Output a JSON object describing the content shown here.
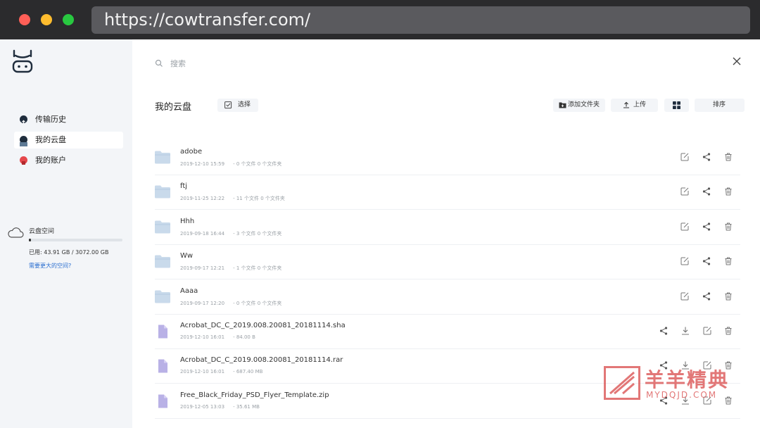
{
  "browser": {
    "url": "https://cowtransfer.com/"
  },
  "sidebar": {
    "items": [
      {
        "label": "传输历史",
        "icon": "upload-circle-icon",
        "color": "#1f2d3d"
      },
      {
        "label": "我的云盘",
        "icon": "disk-icon",
        "color": "#1f2d3d",
        "active": true
      },
      {
        "label": "我的账户",
        "icon": "account-icon",
        "color": "#e5474b"
      }
    ],
    "storage": {
      "title": "云盘空间",
      "used_text": "已用: 43.91 GB / 3072.00 GB",
      "used_fraction": 0.0143,
      "more_link": "需要更大的空间?"
    }
  },
  "search": {
    "placeholder": "搜索"
  },
  "main": {
    "title": "我的云盘",
    "select_label": "选择",
    "toolbar": {
      "add_folder": "添加文件夹",
      "upload": "上传",
      "sort": "排序"
    },
    "rows": [
      {
        "type": "folder",
        "name": "adobe",
        "date": "2019-12-10 15:59",
        "info": "- 0 个文件 0 个文件夹"
      },
      {
        "type": "folder",
        "name": "ftj",
        "date": "2019-11-25 12:22",
        "info": "- 11 个文件 0 个文件夹"
      },
      {
        "type": "folder",
        "name": "Hhh",
        "date": "2019-09-18 16:44",
        "info": "- 3 个文件 0 个文件夹"
      },
      {
        "type": "folder",
        "name": "Ww",
        "date": "2019-09-17 12:21",
        "info": "- 1 个文件 0 个文件夹"
      },
      {
        "type": "folder",
        "name": "Aaaa",
        "date": "2019-09-17 12:20",
        "info": "- 0 个文件 0 个文件夹"
      },
      {
        "type": "file",
        "name": "Acrobat_DC_C_2019.008.20081_20181114.sha",
        "date": "2019-12-10 16:01",
        "info": "- 84.00 B"
      },
      {
        "type": "file",
        "name": "Acrobat_DC_C_2019.008.20081_20181114.rar",
        "date": "2019-12-10 16:01",
        "info": "- 687.40 MB"
      },
      {
        "type": "file",
        "name": "Free_Black_Friday_PSD_Flyer_Template.zip",
        "date": "2019-12-05 13:03",
        "info": "- 35.61 MB"
      }
    ]
  },
  "watermark": {
    "title": "羊羊精典",
    "subtitle": "MYDQJD.COM"
  },
  "colors": {
    "folder": "#c9daeb",
    "file": "#b9b1e6",
    "accent_link": "#2b6fd0"
  }
}
